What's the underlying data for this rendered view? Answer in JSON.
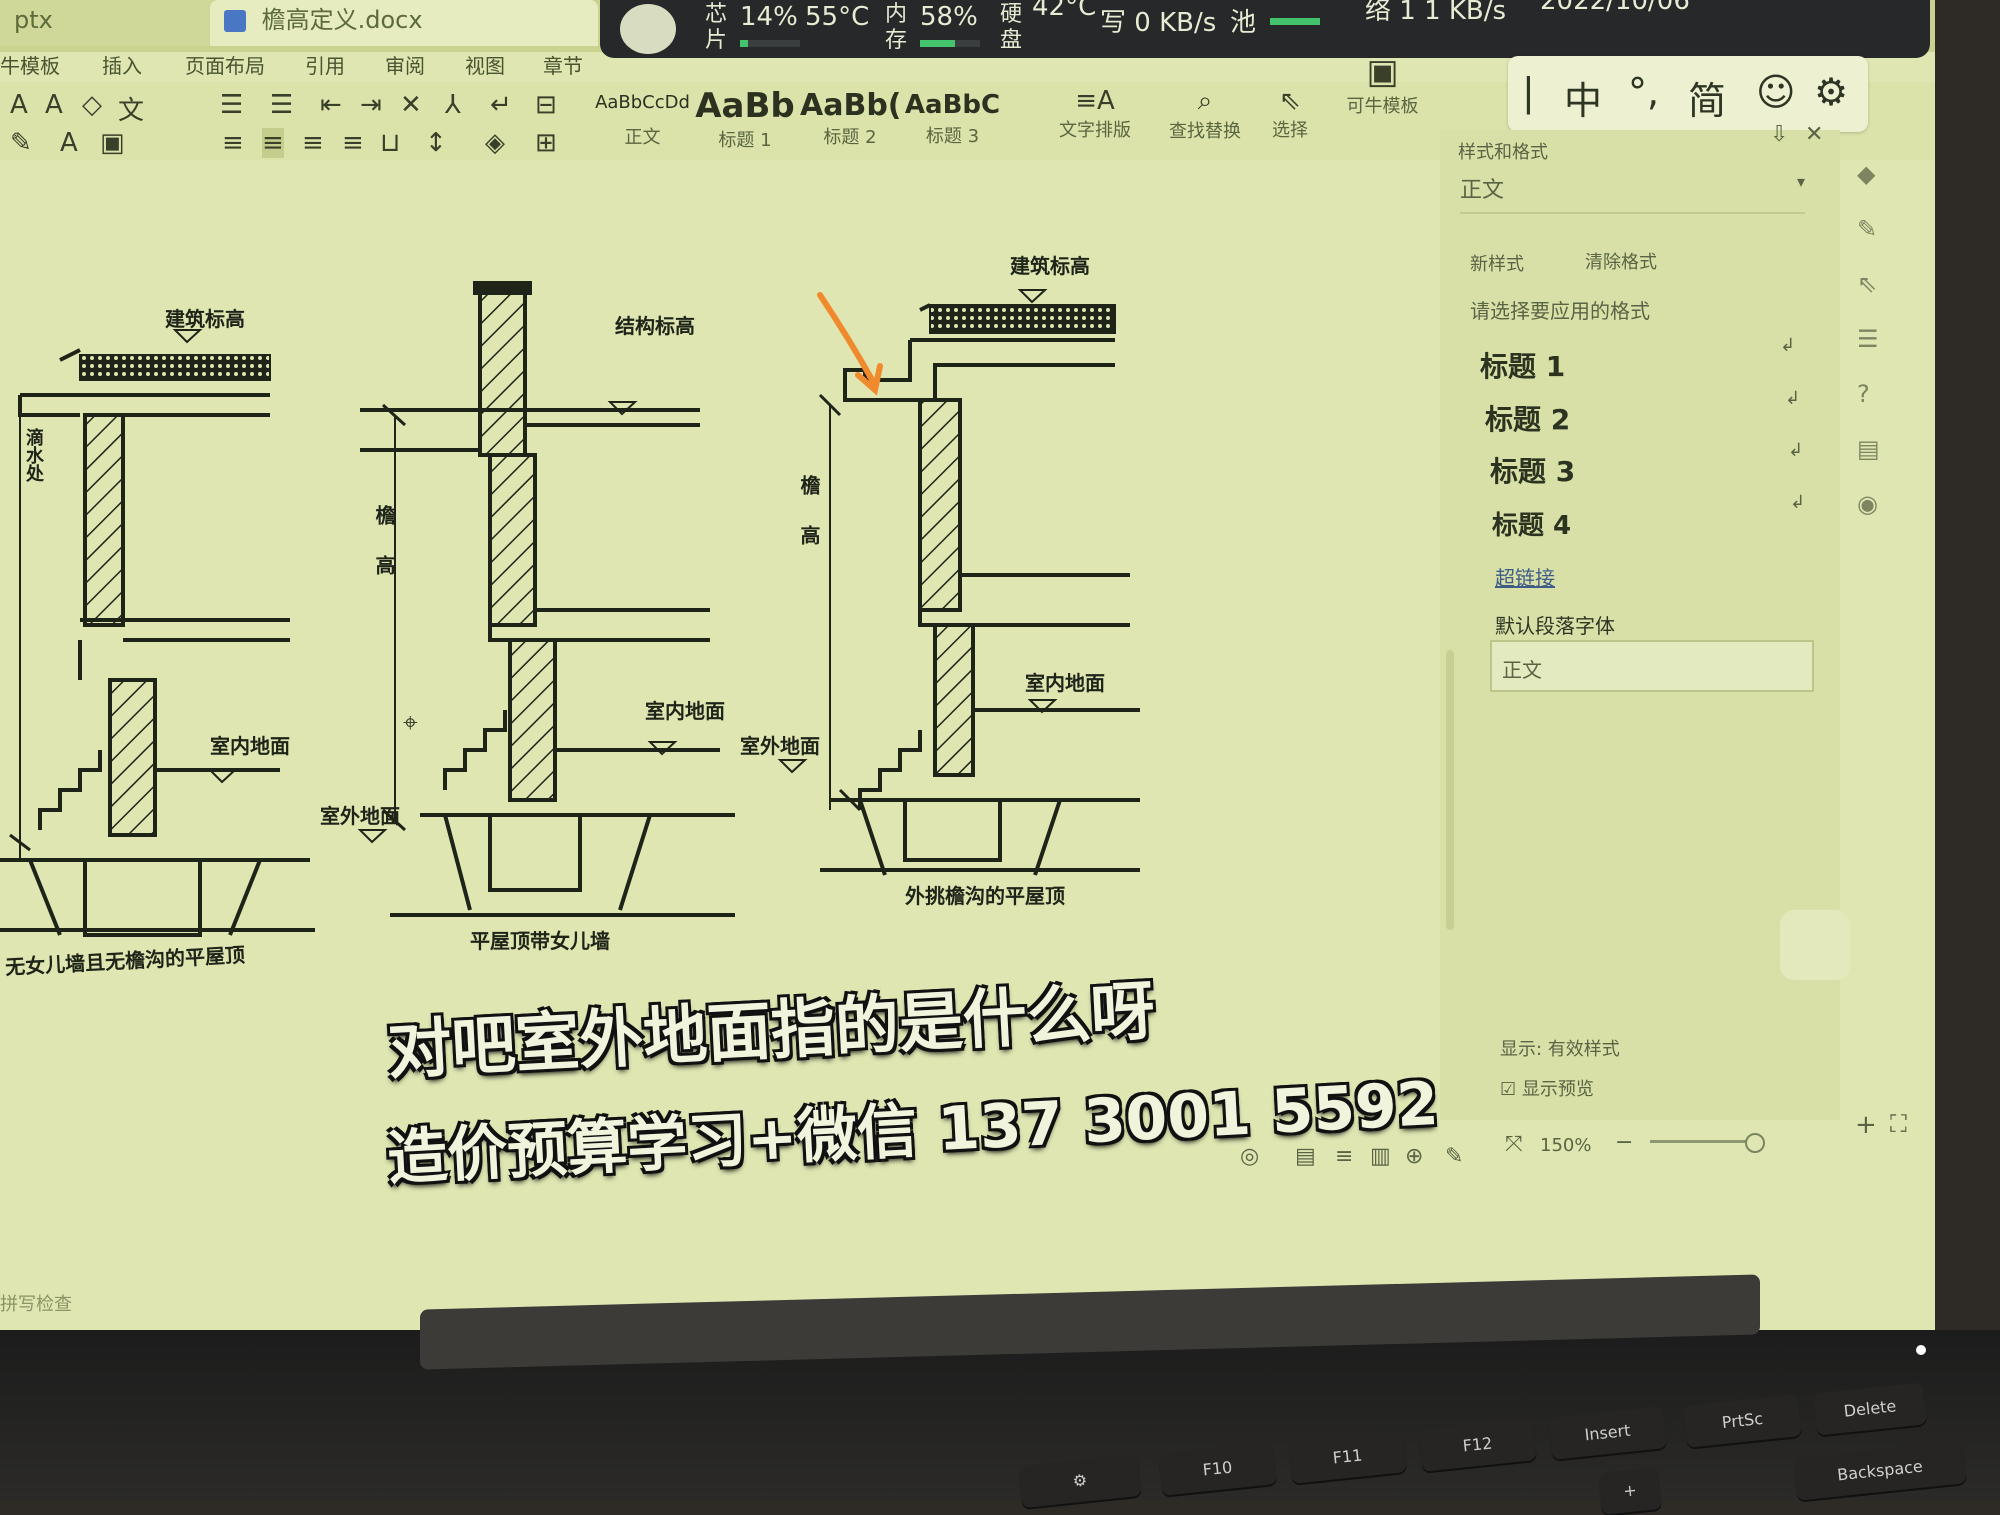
{
  "window": {
    "tab_left": "ptx",
    "tab_doc": "檐高定义.docx"
  },
  "ribbon_tabs": [
    "牛模板",
    "插入",
    "页面布局",
    "引用",
    "审阅",
    "视图",
    "章节"
  ],
  "styles_gallery": {
    "items": [
      {
        "preview": "AaBbCcDd",
        "label": "正文"
      },
      {
        "preview": "AaBb",
        "label": "标题 1"
      },
      {
        "preview": "AaBb(",
        "label": "标题 2"
      },
      {
        "preview": "AaBbC",
        "label": "标题 3"
      }
    ]
  },
  "ribbon_tools": [
    "文字排版",
    "查找替换",
    "选择",
    "可牛模板"
  ],
  "monitor": {
    "chip_label": "芯片",
    "cpu": "14%",
    "temp": "55°C",
    "mem_label": "内存",
    "mem": "58%",
    "disk_label": "硬盘",
    "disk_temp": "42°C",
    "write": "写 0 KB/s",
    "pool_label": "池",
    "net": "络 1 1 KB/s",
    "date": "2022/10/06",
    "cpu_pct": 14,
    "mem_pct": 58,
    "bar_color": "#43c46c"
  },
  "ime": {
    "mode": "中",
    "punct": "°,",
    "variant": "简"
  },
  "diagrams": {
    "d1": {
      "top_label": "建筑标高",
      "side_label": "滴水处",
      "indoor": "室内地面",
      "caption": "无女儿墙且无檐沟的平屋顶"
    },
    "d2": {
      "top_label": "结构标高",
      "height_label": "檐高",
      "indoor": "室内地面",
      "outdoor": "室外地面",
      "caption": "平屋顶带女儿墙"
    },
    "d3": {
      "top_label": "建筑标高",
      "height_label": "檐高",
      "indoor": "室内地面",
      "outdoor": "室外地面",
      "caption": "外挑檐沟的平屋顶"
    }
  },
  "pane": {
    "title": "样式和格式",
    "current": "正文",
    "new_style": "新样式",
    "clear_style": "清除格式",
    "prompt": "请选择要应用的格式",
    "items": [
      "标题 1",
      "标题 2",
      "标题 3",
      "标题 4",
      "超链接",
      "默认段落字体",
      "正文"
    ],
    "show_label": "显示: 有效样式",
    "preview_label": "显示预览"
  },
  "status": {
    "zoom": "150%",
    "left_text": "拼写检查"
  },
  "subtitles": {
    "line1": "对吧室外地面指的是什么呀",
    "line2": "造价预算学习+微信 137 3001 5592"
  },
  "keyboard": {
    "keys": [
      "F10",
      "F11",
      "F12",
      "Insert",
      "PrtSc",
      "Delete",
      "Backspace"
    ]
  },
  "accent_arrow_color": "#f08a2c"
}
